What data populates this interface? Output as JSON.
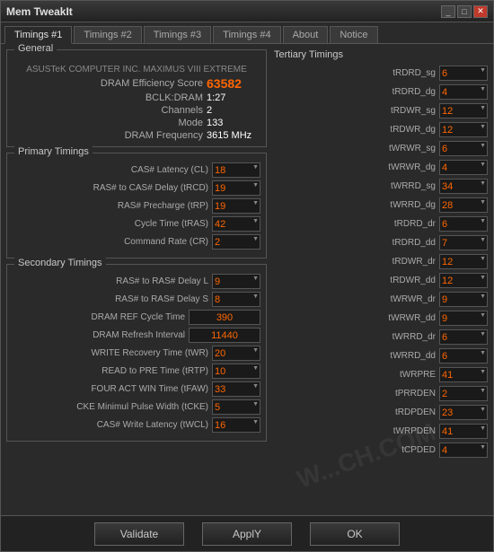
{
  "window": {
    "title": "Mem TweakIt",
    "min_label": "_",
    "max_label": "□",
    "close_label": "✕"
  },
  "tabs": [
    {
      "label": "Timings #1",
      "active": true
    },
    {
      "label": "Timings #2",
      "active": false
    },
    {
      "label": "Timings #3",
      "active": false
    },
    {
      "label": "Timings #4",
      "active": false
    },
    {
      "label": "About",
      "active": false
    },
    {
      "label": "Notice",
      "active": false
    }
  ],
  "general": {
    "title": "General",
    "mobo": "ASUSTeK COMPUTER INC. MAXIMUS VIII EXTREME",
    "fields": [
      {
        "label": "DRAM Efficiency Score",
        "value": "63582",
        "highlight": true
      },
      {
        "label": "BCLK:DRAM",
        "value": "1:27"
      },
      {
        "label": "Channels",
        "value": "2"
      },
      {
        "label": "Mode",
        "value": "133"
      },
      {
        "label": "DRAM Frequency",
        "value": "3615 MHz"
      }
    ]
  },
  "primary": {
    "title": "Primary Timings",
    "rows": [
      {
        "label": "CAS# Latency (CL)",
        "value": "18"
      },
      {
        "label": "RAS# to CAS# Delay (tRCD)",
        "value": "19"
      },
      {
        "label": "RAS# Precharge (tRP)",
        "value": "19"
      },
      {
        "label": "Cycle Time (tRAS)",
        "value": "42"
      },
      {
        "label": "Command Rate (CR)",
        "value": "2"
      }
    ]
  },
  "secondary": {
    "title": "Secondary Timings",
    "rows": [
      {
        "label": "RAS# to RAS# Delay L",
        "value": "9"
      },
      {
        "label": "RAS# to RAS# Delay S",
        "value": "8"
      },
      {
        "label": "DRAM REF Cycle Time",
        "value": "390",
        "wide": true
      },
      {
        "label": "DRAM Refresh Interval",
        "value": "11440",
        "wide": true
      },
      {
        "label": "WRITE Recovery Time (tWR)",
        "value": "20"
      },
      {
        "label": "READ to PRE Time (tRTP)",
        "value": "10"
      },
      {
        "label": "FOUR ACT WIN Time (tFAW)",
        "value": "33"
      },
      {
        "label": "CKE Minimul Pulse Width (tCKE)",
        "value": "5"
      },
      {
        "label": "CAS# Write Latency (tWCL)",
        "value": "16"
      }
    ]
  },
  "tertiary": {
    "title": "Tertiary Timings",
    "rows": [
      {
        "label": "tRDRD_sg",
        "value": "6"
      },
      {
        "label": "tRDRD_dg",
        "value": "4"
      },
      {
        "label": "tRDWR_sg",
        "value": "12"
      },
      {
        "label": "tRDWR_dg",
        "value": "12"
      },
      {
        "label": "tWRWR_sg",
        "value": "6"
      },
      {
        "label": "tWRWR_dg",
        "value": "4"
      },
      {
        "label": "tWRRD_sg",
        "value": "34"
      },
      {
        "label": "tWRRD_dg",
        "value": "28"
      },
      {
        "label": "tRDRD_dr",
        "value": "6"
      },
      {
        "label": "tRDRD_dd",
        "value": "7"
      },
      {
        "label": "tRDWR_dr",
        "value": "12"
      },
      {
        "label": "tRDWR_dd",
        "value": "12"
      },
      {
        "label": "tWRWR_dr",
        "value": "9"
      },
      {
        "label": "tWRWR_dd",
        "value": "9"
      },
      {
        "label": "tWRRD_dr",
        "value": "6"
      },
      {
        "label": "tWRRD_dd",
        "value": "6"
      },
      {
        "label": "tWRPRE",
        "value": "41"
      },
      {
        "label": "tPRRDEN",
        "value": "2"
      },
      {
        "label": "tRDPDEN",
        "value": "23"
      },
      {
        "label": "tWRPDEN",
        "value": "41"
      },
      {
        "label": "tCPDED",
        "value": "4"
      }
    ]
  },
  "buttons": {
    "validate": "Validate",
    "apply": "ApplY",
    "ok": "OK"
  }
}
